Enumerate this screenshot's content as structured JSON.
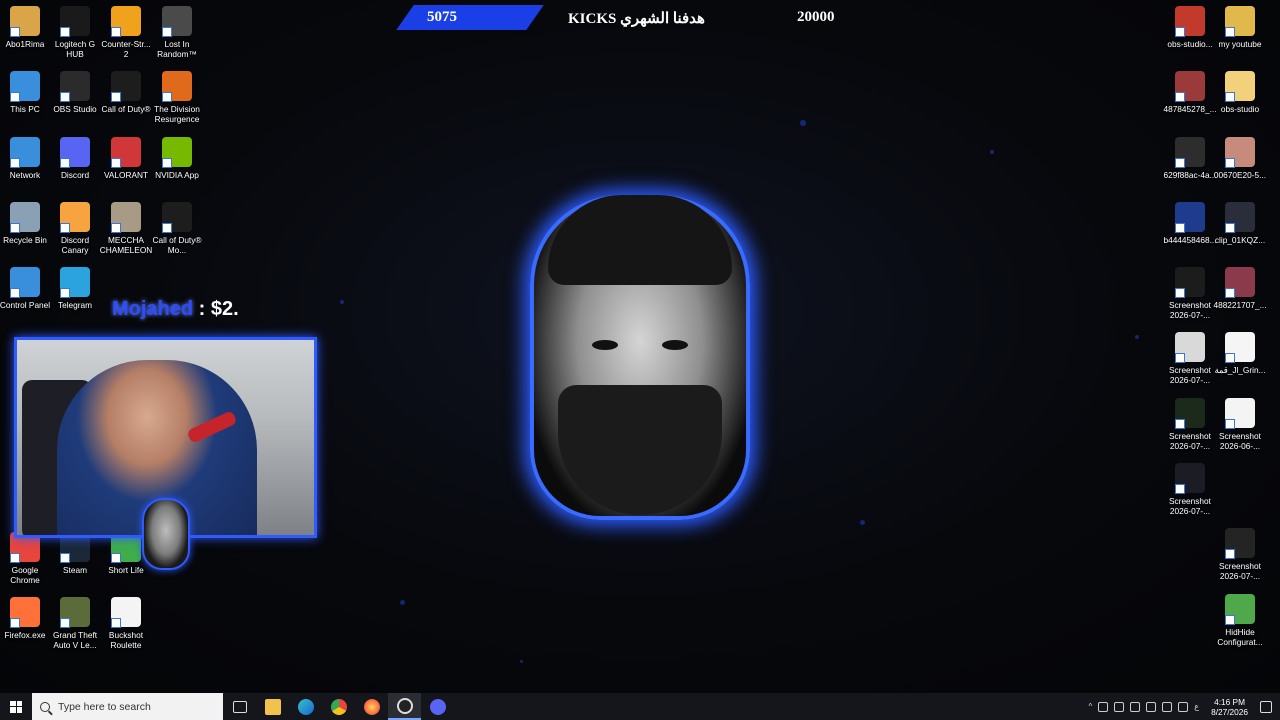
{
  "overlay": {
    "goal_current": "5075",
    "goal_title": "هدفنا الشهري KICKS",
    "goal_target": "20000",
    "donation_name": "Mojahed",
    "donation_amount": " : $2."
  },
  "desktop_left": [
    {
      "label": "Abo1Rima",
      "color": "#d9a548"
    },
    {
      "label": "Logitech G HUB",
      "color": "#1a1a1a"
    },
    {
      "label": "Counter-Str... 2",
      "color": "#f0a21c"
    },
    {
      "label": "Lost In Random™",
      "color": "#4a4a4a"
    },
    {
      "label": "This PC",
      "color": "#3a8fdc"
    },
    {
      "label": "OBS Studio",
      "color": "#2b2b2b"
    },
    {
      "label": "Call of Duty®",
      "color": "#1d1d1d"
    },
    {
      "label": "The Division Resurgence",
      "color": "#e06a1b"
    },
    {
      "label": "Network",
      "color": "#3a8fdc"
    },
    {
      "label": "Discord",
      "color": "#5865f2"
    },
    {
      "label": "VALORANT",
      "color": "#d13639"
    },
    {
      "label": "NVIDIA App",
      "color": "#76b900"
    },
    {
      "label": "Recycle Bin",
      "color": "#8aa0b5"
    },
    {
      "label": "Discord Canary",
      "color": "#f7a440"
    },
    {
      "label": "MECCHA CHAMELEON",
      "color": "#a79b86"
    },
    {
      "label": "Call of Duty® Mo...",
      "color": "#1d1d1d"
    },
    {
      "label": "Control Panel",
      "color": "#3a8fdc"
    },
    {
      "label": "Telegram",
      "color": "#2aa3df"
    },
    {
      "label": "Google Chrome",
      "color": "#e8453c"
    },
    {
      "label": "Steam",
      "color": "#1b2838"
    },
    {
      "label": "Short Life",
      "color": "#3fae4a"
    },
    {
      "label": "Firefox.exe",
      "color": "#ff7139"
    },
    {
      "label": "Grand Theft Auto V Le...",
      "color": "#5c6b3a"
    },
    {
      "label": "Buckshot Roulette",
      "color": "#f4f4f4"
    }
  ],
  "desktop_right": [
    {
      "label": "obs-studio...",
      "color": "#c23a2c"
    },
    {
      "label": "my youtube",
      "color": "#e0b94a"
    },
    {
      "label": "487845278_...",
      "color": "#9a3a3a"
    },
    {
      "label": "obs-studio",
      "color": "#f2d17a"
    },
    {
      "label": "629f88ac-4a...",
      "color": "#2d2d2d"
    },
    {
      "label": "00670E20-5...",
      "color": "#c78b7c"
    },
    {
      "label": "b444458468...",
      "color": "#1f3b8e"
    },
    {
      "label": "clip_01KQZ...",
      "color": "#2a2d3a"
    },
    {
      "label": "Screenshot 2026-07-...",
      "color": "#1c1c1c"
    },
    {
      "label": "488221707_...",
      "color": "#8a3a4a"
    },
    {
      "label": "Screenshot 2026-07-...",
      "color": "#d9d9d9"
    },
    {
      "label": "قمة_Jl_Grin...",
      "color": "#f5f5f5"
    },
    {
      "label": "Screenshot 2026-07-...",
      "color": "#1c2a1c"
    },
    {
      "label": "Screenshot 2026-06-...",
      "color": "#f4f4f4"
    },
    {
      "label": "Screenshot 2026-07-...",
      "color": "#1c1c24"
    },
    {
      "label": "Screenshot 2026-07-...",
      "color": "#242424"
    },
    {
      "label": "HidHide Configurat...",
      "color": "#4fa84a"
    }
  ],
  "taskbar": {
    "search_placeholder": "Type here to search",
    "time": "4:16 PM",
    "date": "8/27/2026",
    "lang": "ع"
  },
  "colors": {
    "accent": "#2f5bff",
    "goal_bar": "#1a3fe6"
  }
}
